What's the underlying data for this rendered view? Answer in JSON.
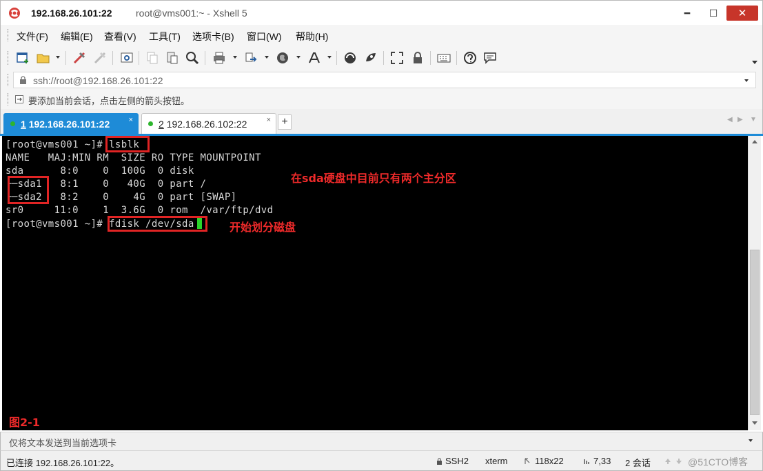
{
  "window": {
    "title_main": "192.168.26.101:22",
    "title_sub": "root@vms001:~ - Xshell 5",
    "minimize_glyph": "━",
    "maximize_glyph": "☐",
    "close_glyph": "✕"
  },
  "menu": {
    "items": [
      "文件(F)",
      "编辑(E)",
      "查看(V)",
      "工具(T)",
      "选项卡(B)",
      "窗口(W)",
      "帮助(H)"
    ]
  },
  "toolbar": {
    "icons": [
      "new-session-icon",
      "open-folder-icon",
      "connect-icon",
      "disconnect-icon",
      "properties-icon",
      "copy-icon",
      "paste-icon",
      "find-icon",
      "print-icon",
      "transfer-icon",
      "globe-icon",
      "font-icon",
      "xftp-icon",
      "xmanager-icon",
      "fullscreen-icon",
      "lock-icon",
      "keyboard-icon",
      "help-icon",
      "chat-icon"
    ]
  },
  "address": {
    "value": "ssh://root@192.168.26.101:22"
  },
  "hint": {
    "text": "要添加当前会话，点击左侧的箭头按钮。"
  },
  "tabs": [
    {
      "number": "1",
      "host": "192.168.26.101:22",
      "active": true,
      "close": "×"
    },
    {
      "number": "2",
      "host": "192.168.26.102:22",
      "active": false,
      "close": "×"
    }
  ],
  "tab_add": "+",
  "tab_nav": {
    "left": "◀",
    "right": "▶",
    "menu": "▼"
  },
  "terminal": {
    "lines": [
      "[root@vms001 ~]# lsblk",
      "NAME   MAJ:MIN RM  SIZE RO TYPE MOUNTPOINT",
      "sda      8:0    0  100G  0 disk",
      "├─sda1   8:1    0   40G  0 part /",
      "└─sda2   8:2    0    4G  0 part [SWAP]",
      "sr0     11:0    1  3.6G  0 rom  /var/ftp/dvd",
      "[root@vms001 ~]# fdisk /dev/sda"
    ],
    "annotations": {
      "partitions_note": "在sda硬盘中目前只有两个主分区",
      "fdisk_note": "开始划分磁盘",
      "figure_label": "图2-1"
    },
    "colors": {
      "background": "#000000",
      "text": "#d8d8d8",
      "cursor": "#2bd62b",
      "annotation": "#ee2a2a"
    }
  },
  "compose": {
    "text": "仅将文本发送到当前选项卡"
  },
  "status": {
    "connection": "已连接 192.168.26.101:22。",
    "protocol": "SSH2",
    "terminal_type": "xterm",
    "size": "118x22",
    "cursor_pos": "7,33",
    "sessions": "2 会话",
    "watermark": "@51CTO博客"
  },
  "accent_color": "#1e8bd7"
}
